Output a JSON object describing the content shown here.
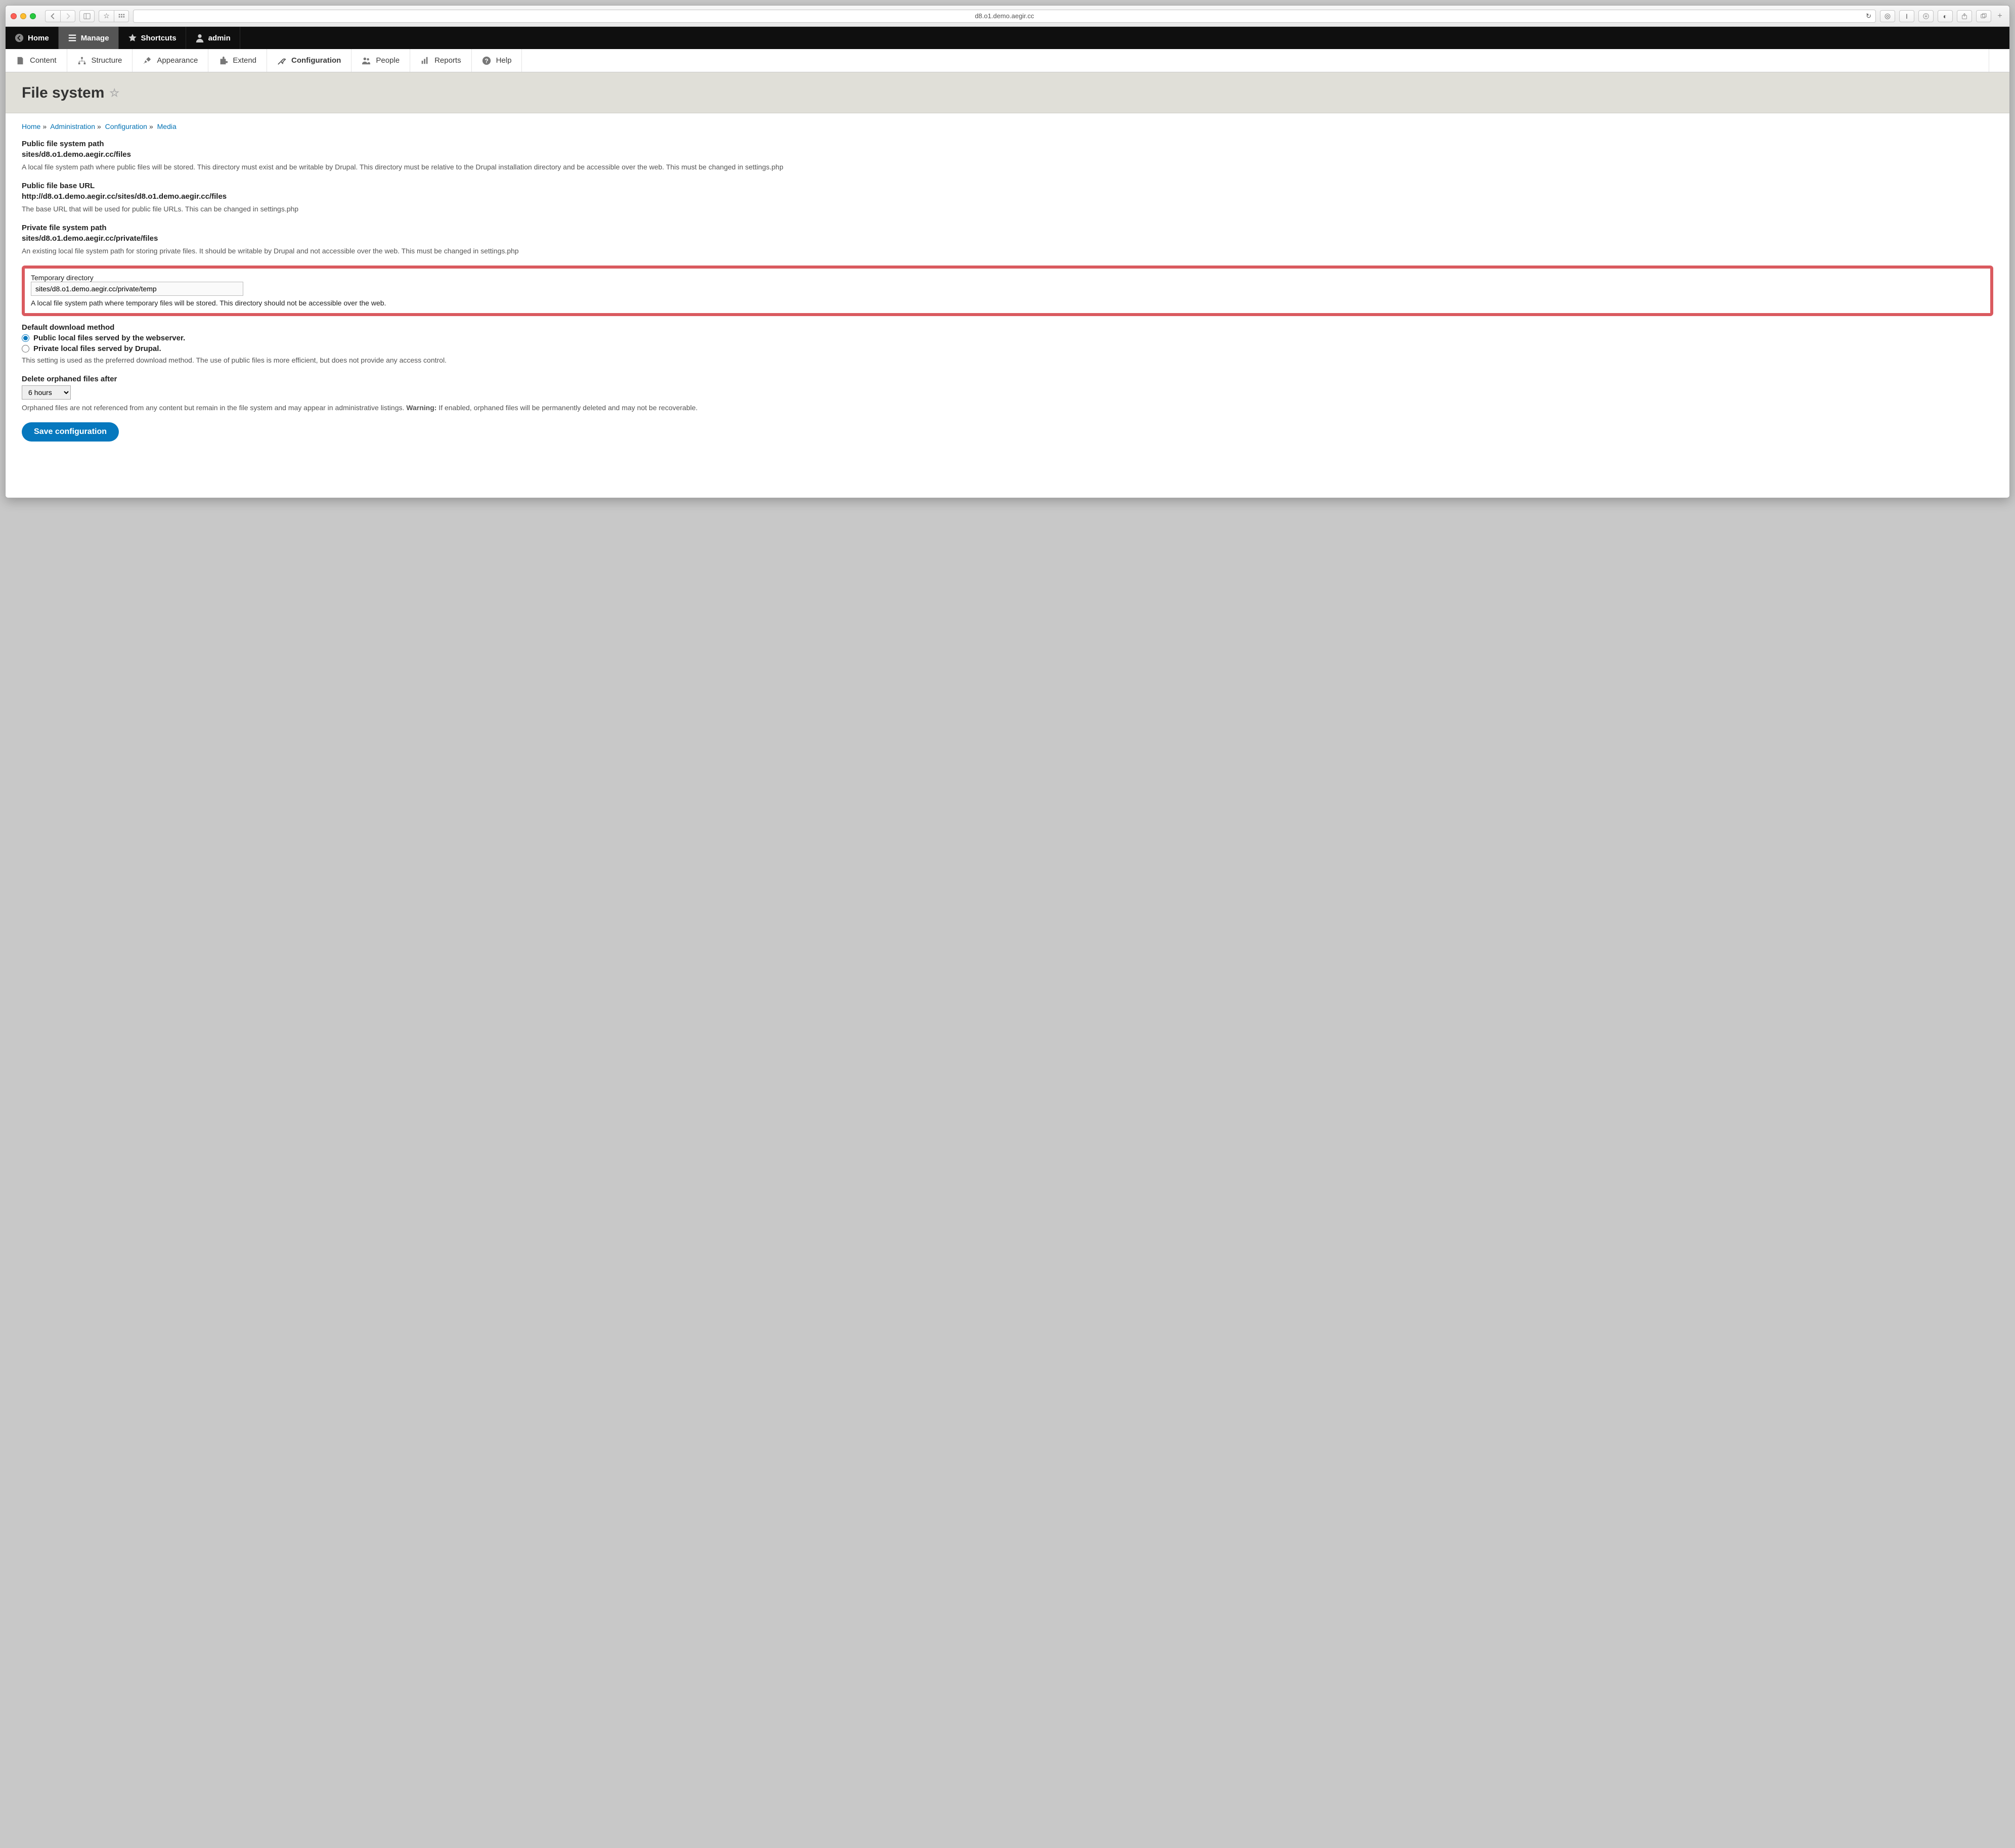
{
  "browser": {
    "url": "d8.o1.demo.aegir.cc"
  },
  "toolbar": {
    "home": "Home",
    "manage": "Manage",
    "shortcuts": "Shortcuts",
    "admin": "admin"
  },
  "admin_menu": {
    "content": "Content",
    "structure": "Structure",
    "appearance": "Appearance",
    "extend": "Extend",
    "configuration": "Configuration",
    "people": "People",
    "reports": "Reports",
    "help": "Help"
  },
  "page_title": "File system",
  "breadcrumb": {
    "home": "Home",
    "administration": "Administration",
    "configuration": "Configuration",
    "media": "Media"
  },
  "public_path": {
    "label": "Public file system path",
    "value": "sites/d8.o1.demo.aegir.cc/files",
    "desc": "A local file system path where public files will be stored. This directory must exist and be writable by Drupal. This directory must be relative to the Drupal installation directory and be accessible over the web. This must be changed in settings.php"
  },
  "public_url": {
    "label": "Public file base URL",
    "value": "http://d8.o1.demo.aegir.cc/sites/d8.o1.demo.aegir.cc/files",
    "desc": "The base URL that will be used for public file URLs. This can be changed in settings.php"
  },
  "private_path": {
    "label": "Private file system path",
    "value": "sites/d8.o1.demo.aegir.cc/private/files",
    "desc": "An existing local file system path for storing private files. It should be writable by Drupal and not accessible over the web. This must be changed in settings.php"
  },
  "temp_dir": {
    "label": "Temporary directory",
    "value": "sites/d8.o1.demo.aegir.cc/private/temp",
    "desc": "A local file system path where temporary files will be stored. This directory should not be accessible over the web."
  },
  "download_method": {
    "label": "Default download method",
    "opt_public": "Public local files served by the webserver.",
    "opt_private": "Private local files served by Drupal.",
    "desc": "This setting is used as the preferred download method. The use of public files is more efficient, but does not provide any access control."
  },
  "orphan": {
    "label": "Delete orphaned files after",
    "value": "6 hours",
    "desc_a": "Orphaned files are not referenced from any content but remain in the file system and may appear in administrative listings. ",
    "warn": "Warning:",
    "desc_b": " If enabled, orphaned files will be permanently deleted and may not be recoverable."
  },
  "save_button": "Save configuration"
}
